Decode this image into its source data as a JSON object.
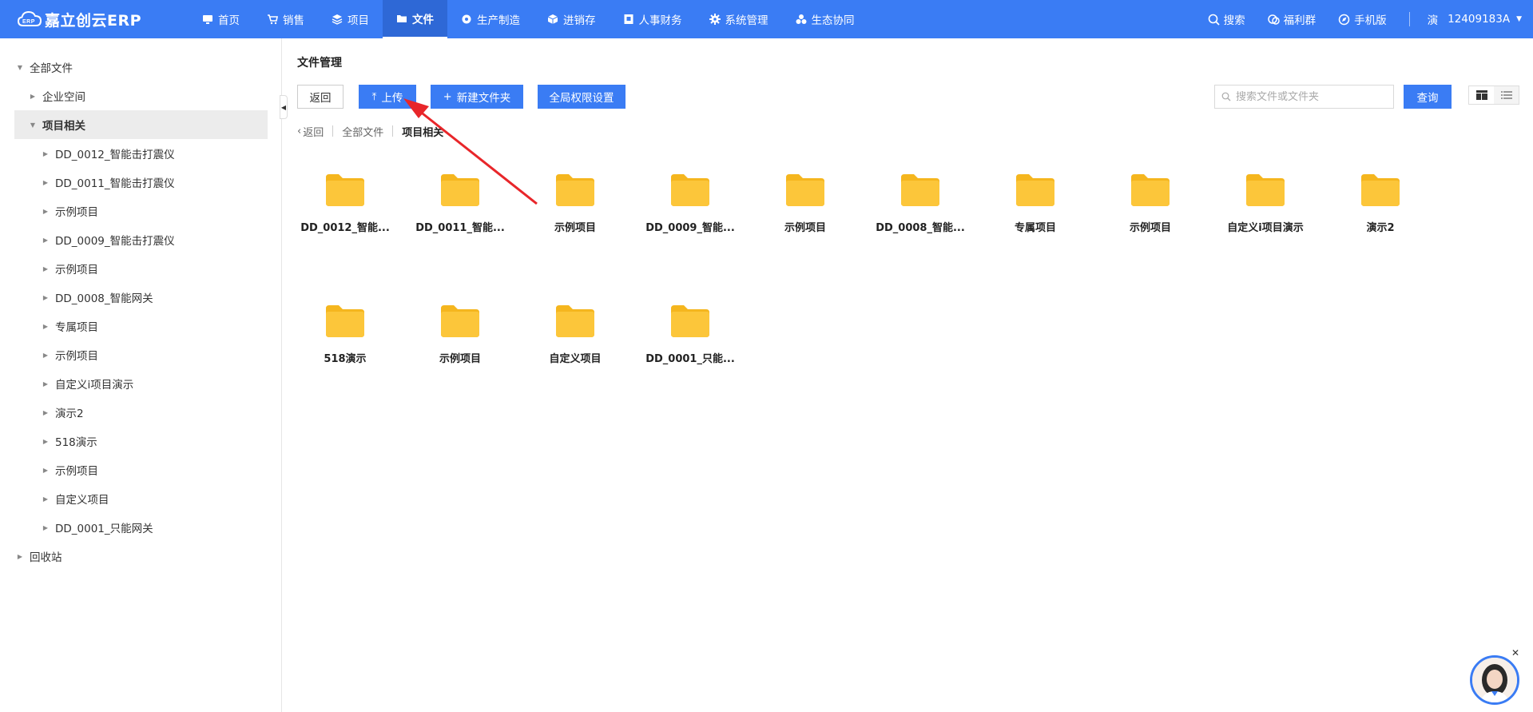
{
  "app": {
    "logo_text": "嘉立创云ERP",
    "accent": "#3a7cf4"
  },
  "nav": [
    {
      "label": "首页",
      "icon": "monitor-icon"
    },
    {
      "label": "销售",
      "icon": "cart-icon"
    },
    {
      "label": "项目",
      "icon": "layers-icon"
    },
    {
      "label": "文件",
      "icon": "folder-icon",
      "active": true
    },
    {
      "label": "生产制造",
      "icon": "gear-box-icon"
    },
    {
      "label": "进销存",
      "icon": "cube-icon"
    },
    {
      "label": "人事财务",
      "icon": "id-card-icon"
    },
    {
      "label": "系统管理",
      "icon": "gear-icon"
    },
    {
      "label": "生态协同",
      "icon": "cluster-icon"
    }
  ],
  "topright": {
    "search": "搜索",
    "welfare": "福利群",
    "mobile": "手机版",
    "user_badge": "演",
    "user_id": "12409183A"
  },
  "sidebar": {
    "items": [
      {
        "label": "全部文件",
        "level": 0,
        "expanded": true
      },
      {
        "label": "企业空间",
        "level": 1,
        "expanded": false
      },
      {
        "label": "项目相关",
        "level": 1,
        "expanded": true,
        "selected": true
      },
      {
        "label": "DD_0012_智能击打震仪",
        "level": 2
      },
      {
        "label": "DD_0011_智能击打震仪",
        "level": 2
      },
      {
        "label": "示例项目",
        "level": 2
      },
      {
        "label": "DD_0009_智能击打震仪",
        "level": 2
      },
      {
        "label": "示例项目",
        "level": 2
      },
      {
        "label": "DD_0008_智能网关",
        "level": 2
      },
      {
        "label": "专属项目",
        "level": 2
      },
      {
        "label": "示例项目",
        "level": 2
      },
      {
        "label": "自定义i项目演示",
        "level": 2
      },
      {
        "label": "演示2",
        "level": 2
      },
      {
        "label": "518演示",
        "level": 2
      },
      {
        "label": "示例项目",
        "level": 2
      },
      {
        "label": "自定义项目",
        "level": 2
      },
      {
        "label": "DD_0001_只能网关",
        "level": 2
      },
      {
        "label": "回收站",
        "level": 0,
        "expanded": false
      }
    ]
  },
  "main": {
    "title": "文件管理",
    "buttons": {
      "back": "返回",
      "upload": "上传",
      "new_folder": "新建文件夹",
      "permissions": "全局权限设置",
      "query": "查询"
    },
    "search_placeholder": "搜索文件或文件夹",
    "breadcrumb": {
      "back": "返回",
      "root": "全部文件",
      "current": "项目相关"
    },
    "folders": [
      "DD_0012_智能...",
      "DD_0011_智能...",
      "示例项目",
      "DD_0009_智能...",
      "示例项目",
      "DD_0008_智能...",
      "专属项目",
      "示例项目",
      "自定义i项目演示",
      "演示2",
      "518演示",
      "示例项目",
      "自定义项目",
      "DD_0001_只能..."
    ]
  },
  "colors": {
    "folder": "#fcc63a",
    "folder_back": "#f5b61e",
    "annotation_arrow": "#e8262a"
  }
}
